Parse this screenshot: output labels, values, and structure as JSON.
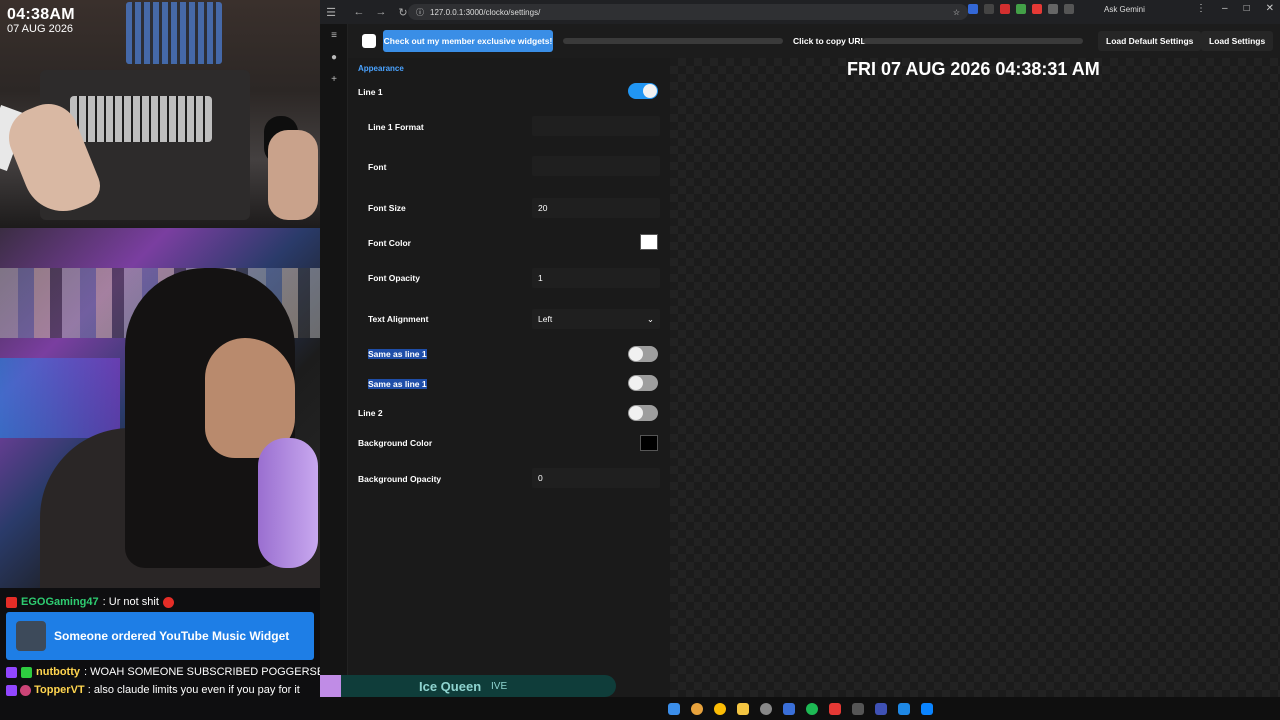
{
  "stream": {
    "clock_time": "04:38AM",
    "clock_date": "07 AUG 2026",
    "chat": [
      {
        "user": "EGOGaming47",
        "message": ": Ur not shit",
        "user_color": "#2ecc71"
      },
      {
        "user": "nutbotty",
        "message": ": WOAH SOMEONE SUBSCRIBED POGGERSE",
        "user_color": "#ffd54f"
      },
      {
        "user": "TopperVT",
        "message": ": also claude limits you even if you pay for it",
        "user_color": "#ffd54f"
      }
    ],
    "alert_text": "Someone ordered YouTube Music Widget"
  },
  "browser": {
    "url": "127.0.0.1:3000/clocko/settings/",
    "ask_gemini": "Ask Gemini"
  },
  "app": {
    "promo_label": "Check out my member exclusive widgets!",
    "copy_url_label": "Click to copy URL",
    "load_default_label": "Load Default Settings",
    "load_label": "Load Settings",
    "section": "Appearance",
    "settings": {
      "line1": "Line 1",
      "line1_format": "Line 1 Format",
      "font": "Font",
      "font_size": "Font Size",
      "font_size_value": "20",
      "font_color": "Font Color",
      "font_opacity": "Font Opacity",
      "font_opacity_value": "1",
      "text_alignment": "Text Alignment",
      "text_alignment_value": "Left",
      "same_as_line1_a": "Same as line 1",
      "same_as_line1_b": "Same as line 1",
      "line2": "Line 2",
      "background_color": "Background Color",
      "background_opacity": "Background Opacity",
      "background_opacity_value": "0"
    },
    "preview_text": "FRI 07 AUG 2026 04:38:31 AM"
  },
  "now_playing": {
    "title": "Ice Queen",
    "artist": "IVE"
  }
}
